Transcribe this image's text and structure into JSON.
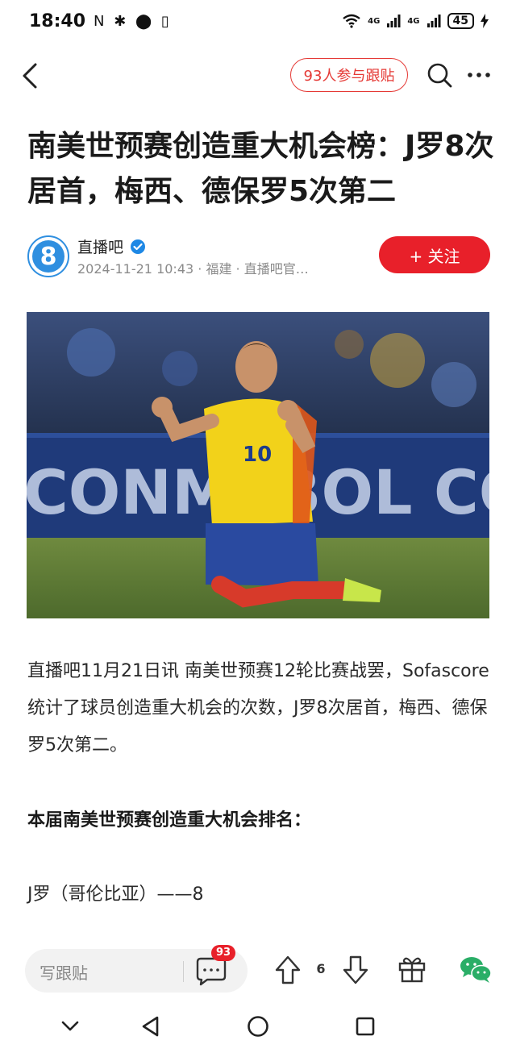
{
  "status_bar": {
    "time": "18:40",
    "left_icons": "N ✱ ⬤ ▯",
    "network_1": "4G",
    "network_2": "4G",
    "battery": "45"
  },
  "nav": {
    "participants_label": "93人参与跟贴"
  },
  "article": {
    "title": "南美世预赛创造重大机会榜：J罗8次居首，梅西、德保罗5次第二",
    "author": {
      "name": "直播吧",
      "avatar_text": "8",
      "meta": "2024-11-21 10:43 · 福建 · 直播吧官…",
      "follow_label": "+ 关注"
    },
    "paragraph_1": "直播吧11月21日讯 南美世预赛12轮比赛战罢，Sofascore统计了球员创造重大机会的次数，J罗8次居首，梅西、德保罗5次第二。",
    "section_heading": "本届南美世预赛创造重大机会排名：",
    "ranking_line": "J罗（哥伦比亚）——8"
  },
  "photo": {
    "banner_text": "CONMEBOL COPA",
    "jersey_number": "10"
  },
  "bottom_bar": {
    "comment_placeholder": "写跟贴",
    "comment_count": "93",
    "vote_count": "6"
  },
  "colors": {
    "accent_red": "#e8202a",
    "avatar_blue": "#2f8fe0",
    "wechat_green": "#2aae67"
  }
}
